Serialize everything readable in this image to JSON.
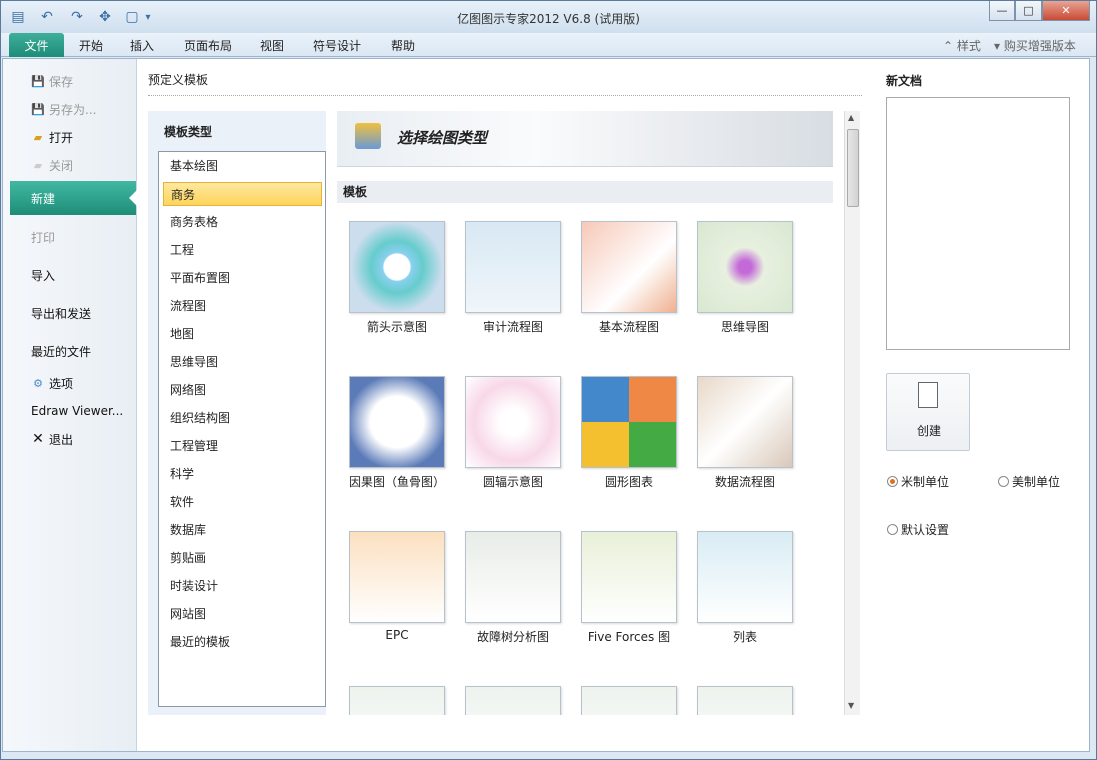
{
  "window": {
    "title": "亿图图示专家2012 V6.8 (试用版)"
  },
  "quick_access": {
    "icons": [
      "app-icon",
      "undo-icon",
      "redo-icon",
      "connector-icon",
      "page-icon",
      "customize-icon"
    ]
  },
  "window_controls": {
    "minimize": "—",
    "maximize": "□",
    "close": "✕"
  },
  "menu": {
    "file": "文件",
    "tabs": [
      "开始",
      "插入",
      "页面布局",
      "视图",
      "符号设计",
      "帮助"
    ],
    "style": "样式",
    "buy": "购买增强版本"
  },
  "leftnav": {
    "save": "保存",
    "save_as": "另存为...",
    "open": "打开",
    "close": "关闭",
    "new": "新建",
    "print": "打印",
    "import": "导入",
    "export": "导出和发送",
    "recent": "最近的文件",
    "options": "选项",
    "viewer": "Edraw Viewer...",
    "exit": "退出"
  },
  "main": {
    "title": "预定义模板",
    "category_header": "模板类型",
    "categories": [
      "基本绘图",
      "商务",
      "商务表格",
      "工程",
      "平面布置图",
      "流程图",
      "地图",
      "思维导图",
      "网络图",
      "组织结构图",
      "工程管理",
      "科学",
      "软件",
      "数据库",
      "剪贴画",
      "时装设计",
      "网站图",
      "最近的模板"
    ],
    "selected_category": "商务",
    "banner_title": "选择绘图类型",
    "templates_header": "模板",
    "templates": [
      "箭头示意图",
      "审计流程图",
      "基本流程图",
      "思维导图",
      "因果图（鱼骨图）",
      "圆辐示意图",
      "圆形图表",
      "数据流程图",
      "EPC",
      "故障树分析图",
      "Five Forces 图",
      "列表"
    ]
  },
  "right": {
    "new_doc": "新文档",
    "create": "创建",
    "metric": "米制单位",
    "us": "美制单位",
    "default": "默认设置"
  }
}
